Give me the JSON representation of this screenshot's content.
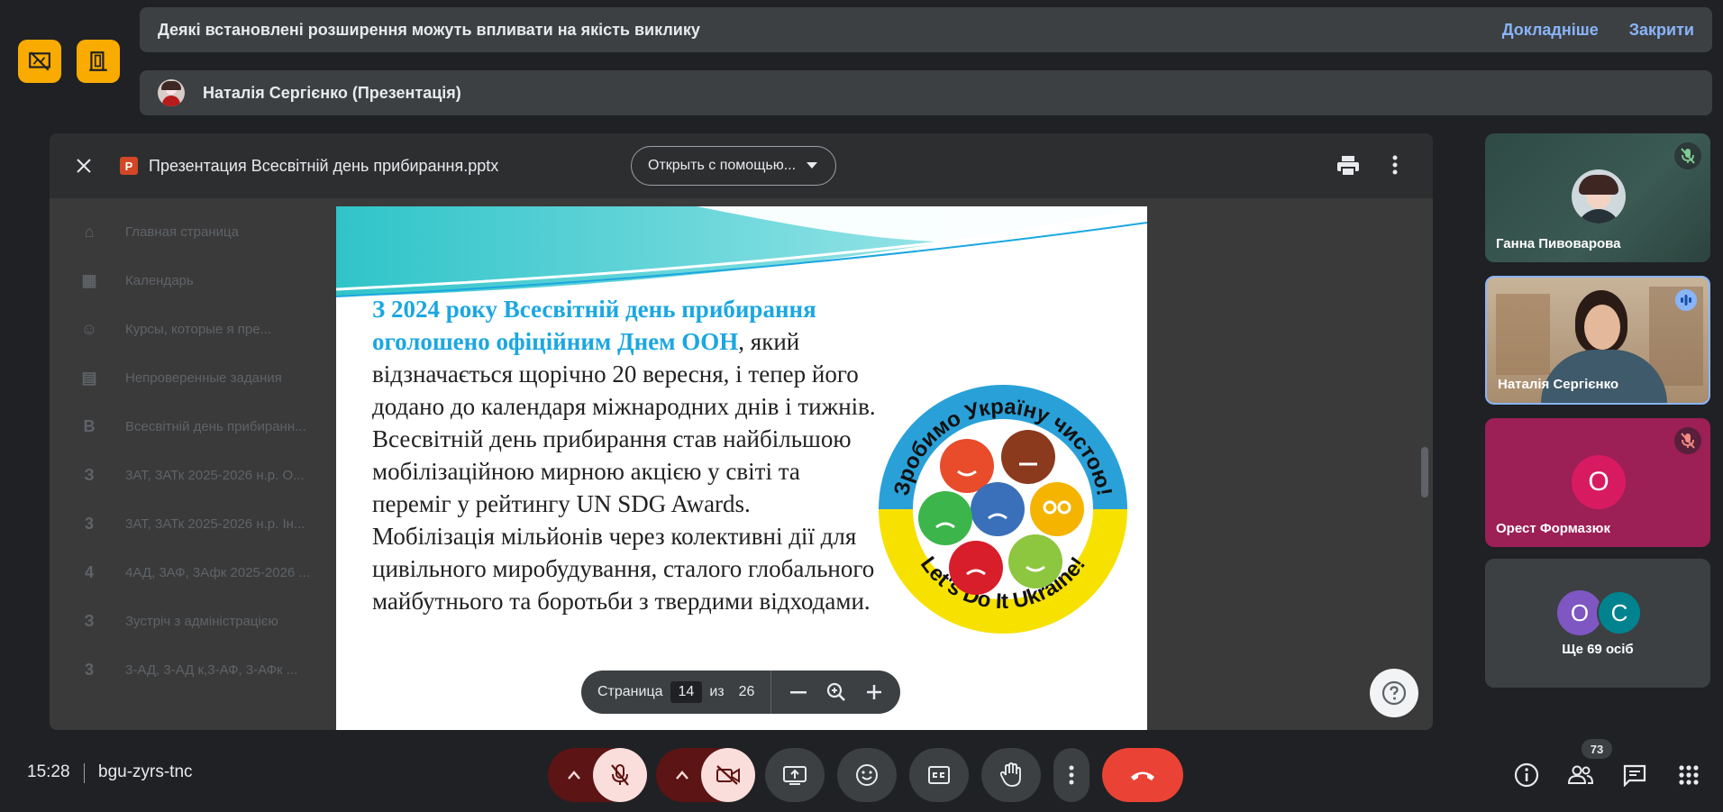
{
  "banner_extensions": {
    "message": "Деякі встановлені розширення можуть впливати на якість виклику",
    "learn_more": "Докладніше",
    "close": "Закрити"
  },
  "banner_presenter": {
    "name": "Наталія Сергієнко (Презентація)"
  },
  "viewer": {
    "title": "Презентация Всесвітній день прибирання.pptx",
    "open_with": "Открыть с помощью..."
  },
  "background_list": [
    {
      "icon": "⌂",
      "label": "Главная страница"
    },
    {
      "icon": "▦",
      "label": "Календарь"
    },
    {
      "icon": "☺",
      "label": "Курсы, которые я пре..."
    },
    {
      "icon": "▤",
      "label": "Непроверенные задания"
    },
    {
      "icon": "В",
      "label": "Всесвітній день прибиранн..."
    },
    {
      "icon": "З",
      "label": "3АТ, 3АТк 2025-2026 н.р. О..."
    },
    {
      "icon": "3",
      "label": "3АТ, 3АТк 2025-2026 н.р. Ін..."
    },
    {
      "icon": "4",
      "label": "4АД, 3АФ, 3Афк 2025-2026 ..."
    },
    {
      "icon": "З",
      "label": "Зустріч з адміністрацією"
    },
    {
      "icon": "3",
      "label": "3-АД, 3-АД к,3-АФ, 3-АФк ..."
    }
  ],
  "slide": {
    "highlight": "З 2024 року Всесвітній день прибирання оголошено офіційним Днем ООН",
    "body": ", який відзначається щорічно 20 вересня, і тепер його додано до календаря міжнародних днів і тижнів. Всесвітній день прибирання став найбільшою мобілізаційною мирною акцією у світі та переміг у рейтингу UN SDG Awards. Мобілізація мільйонів через колективні дії для цивільного миробудування, сталого глобального майбутнього та боротьби з твердими відходами.",
    "logo_top": "Зробимо Україну чистою!",
    "logo_bottom": "Let's Do It Ukraine!"
  },
  "pager": {
    "page_label": "Страница",
    "page": "14",
    "of_label": "из",
    "total": "26"
  },
  "participants": [
    {
      "name": "Ганна Пивоварова",
      "bg": "#33514b"
    },
    {
      "name": "Наталія Сергієнко",
      "bg": "#b59a7c"
    },
    {
      "name": "Орест Формазюк",
      "initial": "О",
      "bg": "#9c1f56",
      "avatar": "#d81b60"
    }
  ],
  "more_tile": {
    "initials": [
      "О",
      "С"
    ],
    "label": "Ще 69 осіб"
  },
  "bottom": {
    "time": "15:28",
    "meeting_code": "bgu-zyrs-tnc",
    "participant_count": "73"
  },
  "colors": {
    "accent": "#8ab4f8",
    "slide_heading": "#1ba7e0",
    "end_call": "#ea4335",
    "badge": "#f9ab00"
  }
}
